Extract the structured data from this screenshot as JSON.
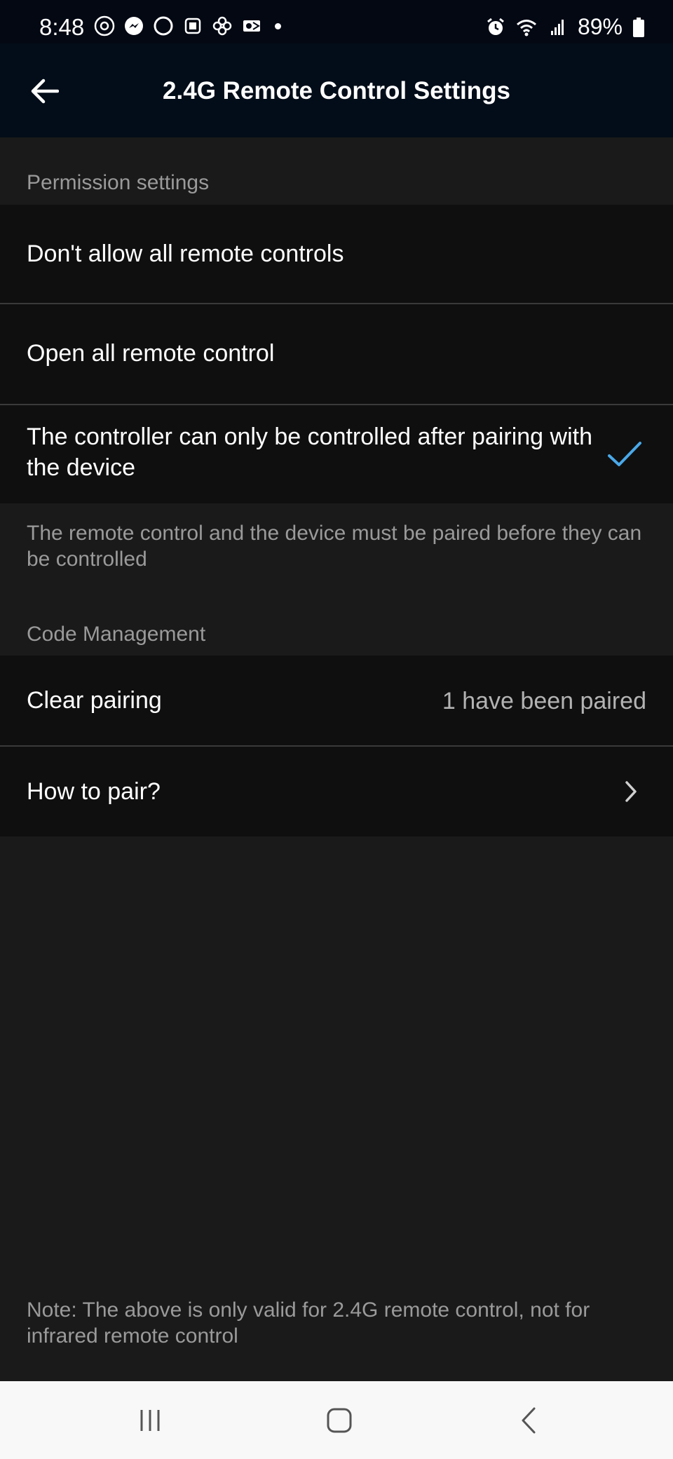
{
  "status_bar": {
    "time": "8:48",
    "battery": "89%",
    "left_icons": [
      "threads-icon",
      "messenger-icon",
      "circle-app-icon",
      "game-app-icon",
      "pinwheel-icon",
      "outlook-icon"
    ],
    "right_icons": [
      "alarm-icon",
      "wifi-icon",
      "signal-icon",
      "battery-icon"
    ]
  },
  "header": {
    "title": "2.4G Remote Control Settings"
  },
  "permission_section": {
    "header": "Permission settings",
    "options": [
      {
        "label": "Don't allow all remote controls",
        "selected": false
      },
      {
        "label": "Open all remote control",
        "selected": false
      },
      {
        "label": "The controller can only be controlled after pairing with the device",
        "selected": true
      }
    ],
    "helper": "The remote control and the device must be paired before they can be controlled"
  },
  "code_section": {
    "header": "Code Management",
    "clear_pairing": {
      "label": "Clear pairing",
      "value": "1 have been paired"
    },
    "how_to_pair": {
      "label": "How to pair?"
    }
  },
  "note": "Note: The above is only valid for 2.4G remote control, not for infrared remote control",
  "colors": {
    "accent": "#4aa8e8",
    "background": "#1a1a1a",
    "row_background": "#0f0f0f",
    "header_background": "#030d19"
  }
}
